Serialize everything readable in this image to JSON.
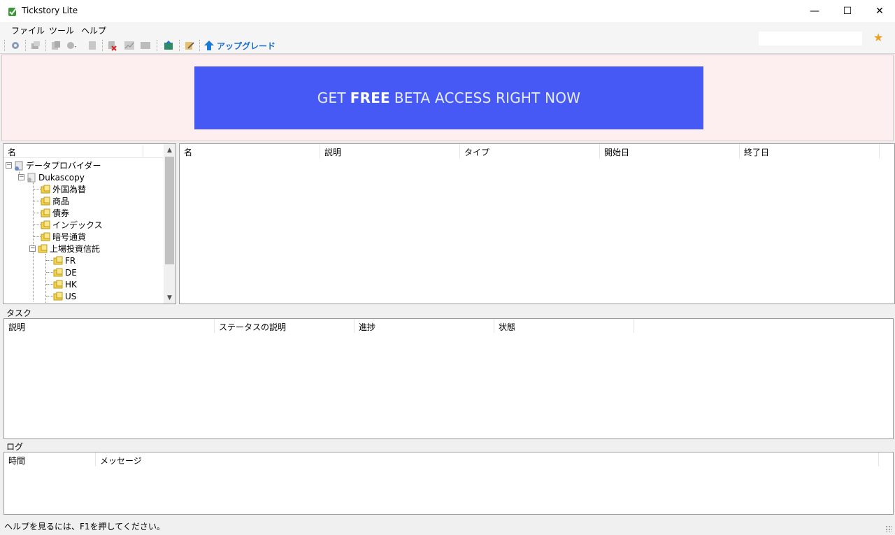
{
  "window": {
    "title": "Tickstory Lite",
    "controls": {
      "minimize": "—",
      "maximize": "☐",
      "close": "✕"
    }
  },
  "menu": [
    "ファイル",
    "ツール",
    "ヘルプ"
  ],
  "toolbar": {
    "upgrade_label": "アップグレード",
    "icons": [
      "settings-icon",
      "layers-icon",
      "copy-icon",
      "gear-dropdown-icon",
      "document-icon",
      "delete-icon",
      "chart-icon",
      "table-icon",
      "export-icon",
      "edit-icon",
      "upgrade-arrow-icon",
      "star-icon"
    ]
  },
  "banner": {
    "prefix": "GET",
    "bold": "FREE",
    "suffix": "BETA ACCESS RIGHT NOW",
    "color": "#4659f5"
  },
  "tree": {
    "header": "名",
    "root": "データプロバイダー",
    "provider": "Dukascopy",
    "categories": [
      "外国為替",
      "商品",
      "債券",
      "インデックス",
      "暗号通貨",
      "上場投資信託"
    ],
    "etf_children": [
      "FR",
      "DE",
      "HK",
      "US"
    ]
  },
  "list": {
    "columns": [
      "名",
      "説明",
      "タイプ",
      "開始日",
      "終了日"
    ]
  },
  "tasks": {
    "label": "タスク",
    "columns": [
      "説明",
      "ステータスの説明",
      "進捗",
      "状態"
    ]
  },
  "log": {
    "label": "ログ",
    "columns": [
      "時間",
      "メッセージ"
    ]
  },
  "status": {
    "text": "ヘルプを見るには、F1を押してください。"
  }
}
